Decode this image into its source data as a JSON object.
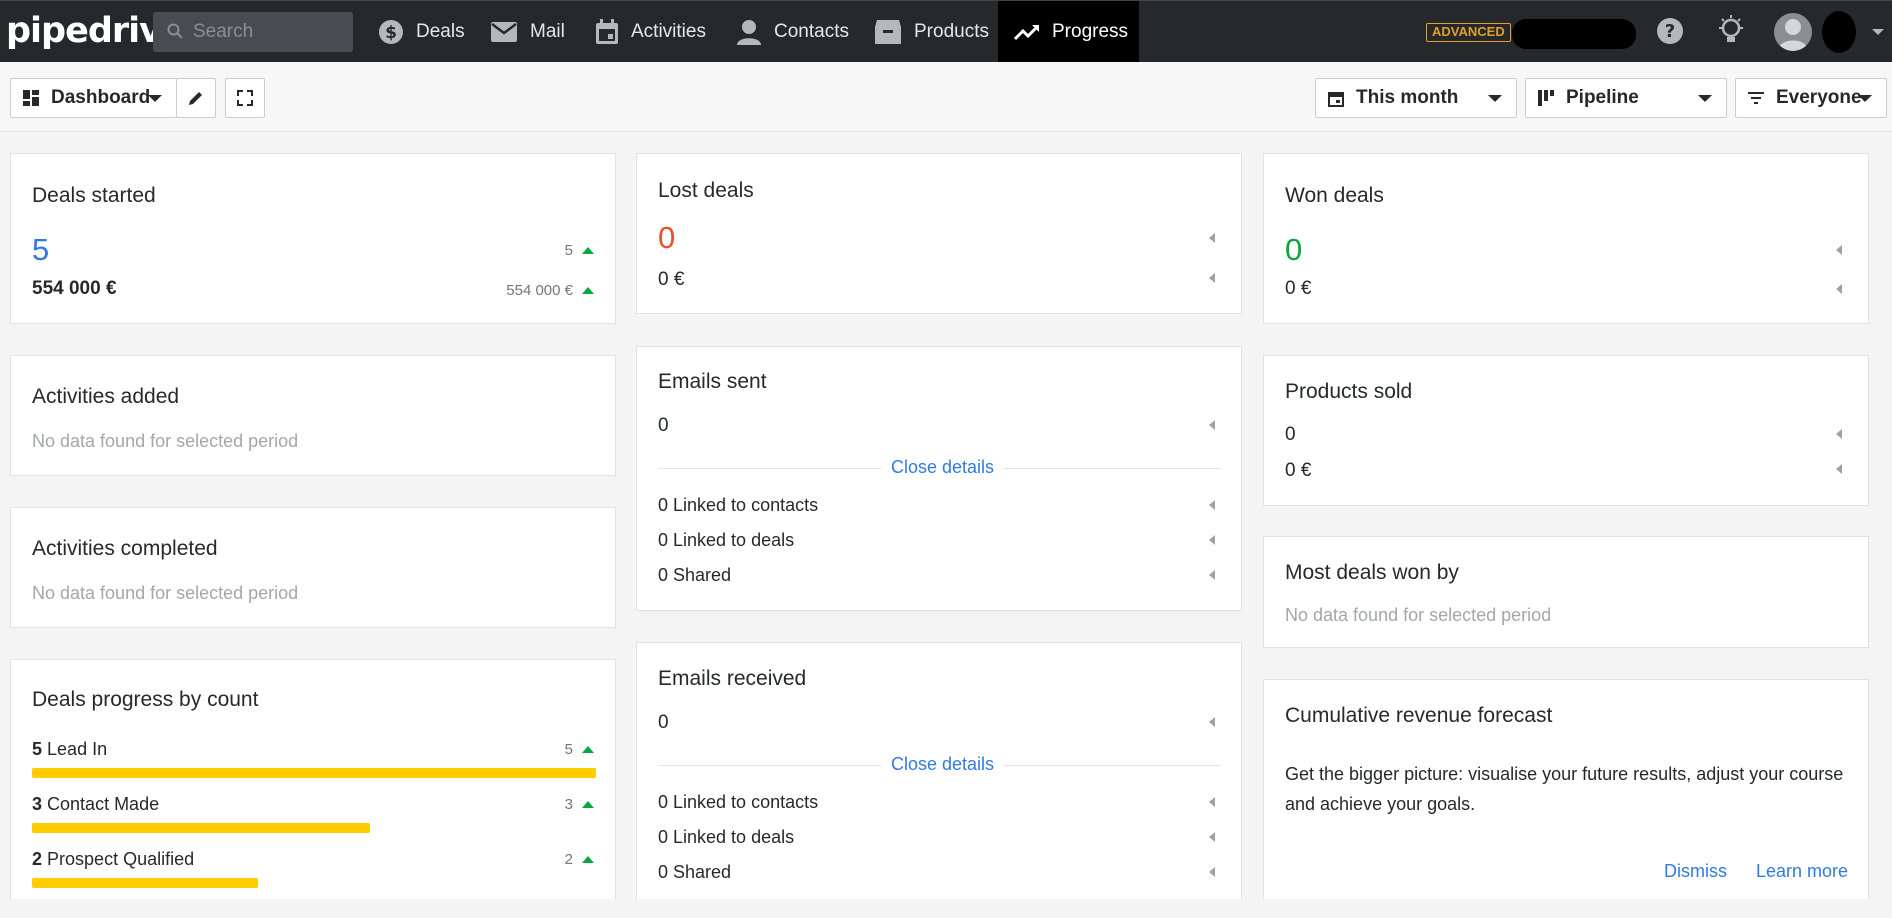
{
  "nav": {
    "logo": "pipedrive",
    "search_placeholder": "Search",
    "items": [
      {
        "label": "Deals",
        "icon": "dollar-icon"
      },
      {
        "label": "Mail",
        "icon": "mail-icon"
      },
      {
        "label": "Activities",
        "icon": "calendar-icon"
      },
      {
        "label": "Contacts",
        "icon": "person-icon"
      },
      {
        "label": "Products",
        "icon": "box-icon"
      },
      {
        "label": "Progress",
        "icon": "trending-up-icon",
        "active": true
      }
    ],
    "plan_badge": "ADVANCED"
  },
  "toolbar": {
    "dashboard": "Dashboard",
    "period": "This month",
    "pipeline": "Pipeline",
    "owner": "Everyone"
  },
  "cards": {
    "deals_started": {
      "title": "Deals started",
      "count": "5",
      "amount": "554 000 €",
      "count_trend": "5",
      "amount_trend": "554 000 €"
    },
    "activities_added": {
      "title": "Activities added",
      "empty": "No data found for selected period"
    },
    "activities_completed": {
      "title": "Activities completed",
      "empty": "No data found for selected period"
    },
    "deals_progress": {
      "title": "Deals progress by count",
      "rows": [
        {
          "count": "5",
          "stage": "Lead In",
          "trend": "5",
          "fraction": 1.0
        },
        {
          "count": "3",
          "stage": "Contact Made",
          "trend": "3",
          "fraction": 0.6
        },
        {
          "count": "2",
          "stage": "Prospect Qualified",
          "trend": "2",
          "fraction": 0.4
        }
      ]
    },
    "lost_deals": {
      "title": "Lost deals",
      "count": "0",
      "amount": "0 €"
    },
    "emails_sent": {
      "title": "Emails sent",
      "count": "0",
      "details_link": "Close details",
      "contacts": "0 Linked to contacts",
      "deals": "0 Linked to deals",
      "shared": "0 Shared"
    },
    "emails_received": {
      "title": "Emails received",
      "count": "0",
      "details_link": "Close details",
      "contacts": "0 Linked to contacts",
      "deals": "0 Linked to deals",
      "shared": "0 Shared"
    },
    "won_deals": {
      "title": "Won deals",
      "count": "0",
      "amount": "0 €"
    },
    "products_sold": {
      "title": "Products sold",
      "count": "0",
      "amount": "0 €"
    },
    "most_deals_won": {
      "title": "Most deals won by",
      "empty": "No data found for selected period"
    },
    "forecast": {
      "title": "Cumulative revenue forecast",
      "text": "Get the bigger picture: visualise your future results, adjust your course and achieve your goals.",
      "dismiss": "Dismiss",
      "learn_more": "Learn more"
    }
  },
  "colors": {
    "accent": "#317ae2",
    "lost": "#e8502f",
    "won": "#08a742",
    "bar": "#ffcc00",
    "nav_bg": "#26292c"
  }
}
